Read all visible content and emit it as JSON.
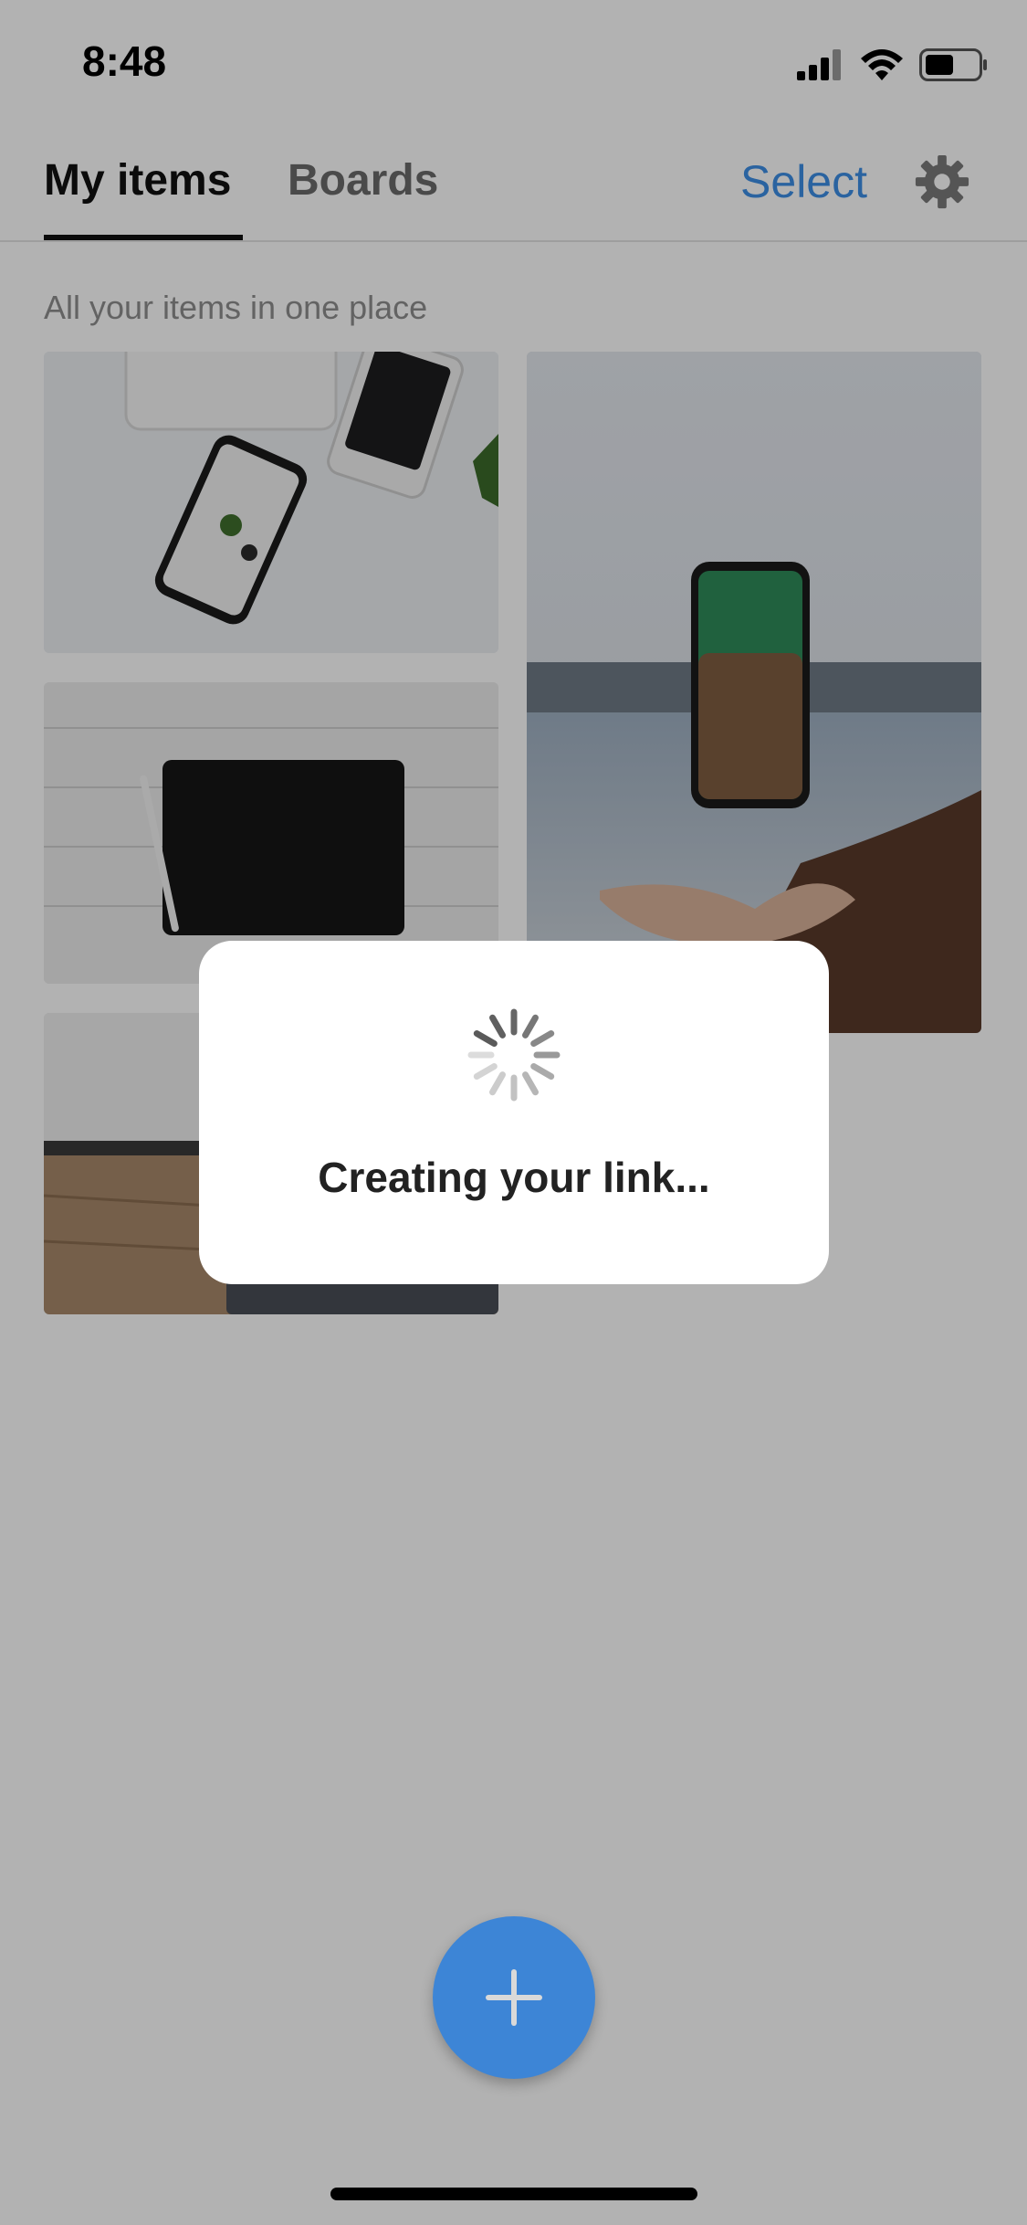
{
  "status_bar": {
    "time": "8:48"
  },
  "tabs": {
    "my_items": "My items",
    "boards": "Boards"
  },
  "header": {
    "select_label": "Select"
  },
  "subtitle": "All your items in one place",
  "modal": {
    "message": "Creating your link..."
  },
  "icons": [
    "signal-icon",
    "wifi-icon",
    "battery-icon",
    "gear-icon",
    "spinner-icon",
    "plus-icon"
  ],
  "colors": {
    "accent": "#3d85d6",
    "select_link": "#3d8fe6"
  }
}
